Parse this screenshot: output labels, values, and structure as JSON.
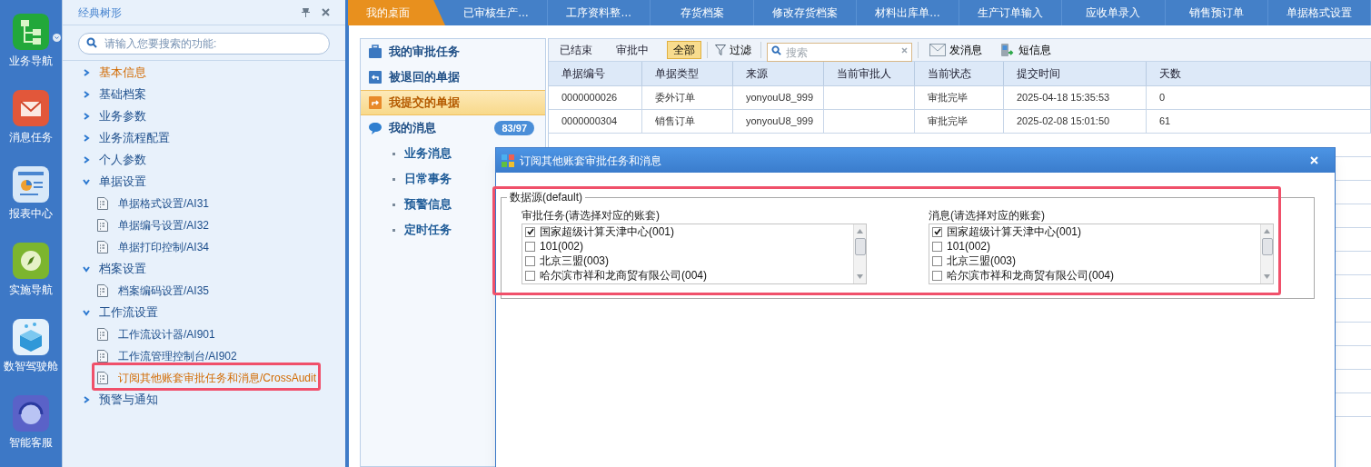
{
  "nav_rail": [
    {
      "label": "业务导航",
      "kind": "tree"
    },
    {
      "label": "消息任务",
      "kind": "mail"
    },
    {
      "label": "报表中心",
      "kind": "report"
    },
    {
      "label": "实施导航",
      "kind": "compass"
    },
    {
      "label": "数智驾驶舱",
      "kind": "cube"
    },
    {
      "label": "智能客服",
      "kind": "service"
    }
  ],
  "tree_panel": {
    "title": "经典树形",
    "search": {
      "placeholder": "请输入您要搜索的功能:"
    },
    "items": [
      {
        "label": "基本信息",
        "selected": true,
        "expanded": false
      },
      {
        "label": "基础档案",
        "selected": false,
        "expanded": false
      },
      {
        "label": "业务参数",
        "selected": false,
        "expanded": false
      },
      {
        "label": "业务流程配置",
        "selected": false,
        "expanded": false
      },
      {
        "label": "个人参数",
        "selected": false,
        "expanded": false
      },
      {
        "label": "单据设置",
        "selected": false,
        "expanded": true,
        "children": [
          {
            "label": "单据格式设置/AI31",
            "selected": false
          },
          {
            "label": "单据编号设置/AI32",
            "selected": false
          },
          {
            "label": "单据打印控制/AI34",
            "selected": false
          }
        ]
      },
      {
        "label": "档案设置",
        "selected": false,
        "expanded": true,
        "children": [
          {
            "label": "档案编码设置/AI35",
            "selected": false
          }
        ]
      },
      {
        "label": "工作流设置",
        "selected": false,
        "expanded": true,
        "children": [
          {
            "label": "工作流设计器/AI901",
            "selected": false
          },
          {
            "label": "工作流管理控制台/AI902",
            "selected": false
          },
          {
            "label": "订阅其他账套审批任务和消息/CrossAudit",
            "selected": true
          }
        ]
      },
      {
        "label": "预警与通知",
        "selected": false,
        "expanded": false
      }
    ]
  },
  "tabs": [
    {
      "label": "我的桌面",
      "selected": true
    },
    {
      "label": "已审核生产…",
      "selected": false
    },
    {
      "label": "工序资料整…",
      "selected": false
    },
    {
      "label": "存货档案",
      "selected": false
    },
    {
      "label": "修改存货档案",
      "selected": false
    },
    {
      "label": "材料出库单…",
      "selected": false
    },
    {
      "label": "生产订单输入",
      "selected": false
    },
    {
      "label": "应收单录入",
      "selected": false
    },
    {
      "label": "销售预订单",
      "selected": false
    },
    {
      "label": "单据格式设置",
      "selected": false
    }
  ],
  "side_nav": {
    "items": [
      {
        "label": "我的审批任务",
        "kind": "briefcase",
        "selected": false
      },
      {
        "label": "被退回的单据",
        "kind": "return",
        "selected": false
      },
      {
        "label": "我提交的单据",
        "kind": "submit",
        "selected": true
      },
      {
        "label": "我的消息",
        "kind": "message",
        "selected": false,
        "badge": "83/97",
        "children": [
          {
            "label": "业务消息"
          },
          {
            "label": "日常事务"
          },
          {
            "label": "预警信息"
          },
          {
            "label": "定时任务"
          }
        ]
      }
    ]
  },
  "toolbar": {
    "status_filters": [
      {
        "label": "已结束",
        "selected": false
      },
      {
        "label": "审批中",
        "selected": false
      },
      {
        "label": "全部",
        "selected": true
      }
    ],
    "filter": "过滤",
    "search": {
      "placeholder": "搜索"
    },
    "actions": [
      {
        "label": "发消息",
        "kind": "mail"
      },
      {
        "label": "短信息",
        "kind": "phone"
      }
    ]
  },
  "table": {
    "columns": [
      "单据编号",
      "单据类型",
      "来源",
      "当前审批人",
      "当前状态",
      "提交时间",
      "天数"
    ],
    "rows": [
      [
        "0000000026",
        "委外订单",
        "yonyouU8_999",
        "",
        "审批完毕",
        "2025-04-18 15:35:53",
        "0"
      ],
      [
        "0000000304",
        "销售订单",
        "yonyouU8_999",
        "",
        "审批完毕",
        "2025-02-08 15:01:50",
        "61"
      ]
    ]
  },
  "dialog": {
    "title": "订阅其他账套审批任务和消息",
    "group": "数据源(default)",
    "lists": [
      {
        "label": "审批任务(请选择对应的账套)",
        "items": [
          {
            "label": "国家超级计算天津中心(001)",
            "checked": true
          },
          {
            "label": "101(002)",
            "checked": false
          },
          {
            "label": "北京三盟(003)",
            "checked": false
          },
          {
            "label": "哈尔滨市祥和龙商贸有限公司(004)",
            "checked": false
          }
        ]
      },
      {
        "label": "消息(请选择对应的账套)",
        "items": [
          {
            "label": "国家超级计算天津中心(001)",
            "checked": true
          },
          {
            "label": "101(002)",
            "checked": false
          },
          {
            "label": "北京三盟(003)",
            "checked": false
          },
          {
            "label": "哈尔滨市祥和龙商贸有限公司(004)",
            "checked": false
          }
        ]
      }
    ]
  }
}
